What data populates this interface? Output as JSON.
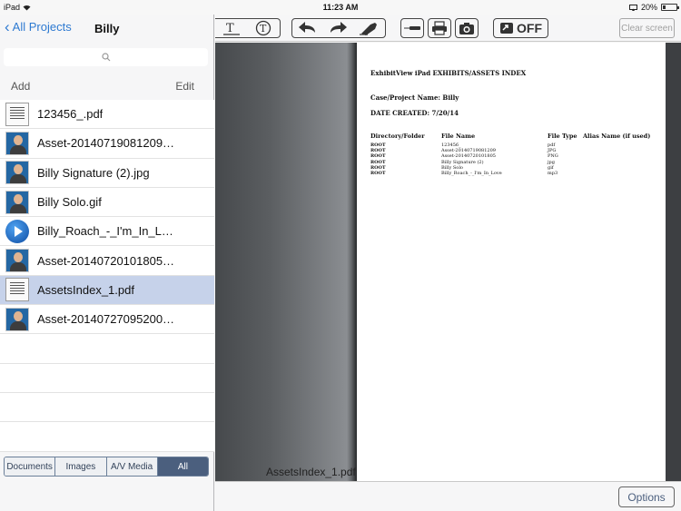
{
  "status_bar": {
    "device": "iPad",
    "time": "11:23 AM",
    "battery": "20%"
  },
  "left_pane": {
    "back_label": "All Projects",
    "title": "Billy",
    "add_label": "Add",
    "edit_label": "Edit",
    "files": [
      {
        "name": "123456_.pdf",
        "icon": "document-icon"
      },
      {
        "name": "Asset-20140719081209…",
        "icon": "image-thumbnail-icon"
      },
      {
        "name": "Billy Signature (2).jpg",
        "icon": "image-thumbnail-icon"
      },
      {
        "name": "Billy Solo.gif",
        "icon": "image-thumbnail-icon"
      },
      {
        "name": "Billy_Roach_-_I'm_In_L…",
        "icon": "media-play-icon"
      },
      {
        "name": "Asset-20140720101805…",
        "icon": "image-thumbnail-icon"
      },
      {
        "name": "AssetsIndex_1.pdf",
        "icon": "document-icon",
        "selected": true
      },
      {
        "name": "Asset-20140727095200…",
        "icon": "image-thumbnail-icon"
      }
    ],
    "filter_tabs": [
      "Documents",
      "Images",
      "A/V Media",
      "All"
    ],
    "active_filter": "All"
  },
  "toolbar": {
    "clear_screen_label": "Clear screen",
    "toggle_label": "OFF",
    "icons": [
      "text-tool-icon",
      "text-circle-tool-icon",
      "undo-icon",
      "redo-icon",
      "eraser-icon",
      "pen-icon",
      "print-icon",
      "camera-icon",
      "presentation-toggle-icon"
    ]
  },
  "document": {
    "heading": "ExhibitView iPad EXHIBITS/ASSETS INDEX",
    "case_line": "Case/Project Name: Billy",
    "date_line": "DATE CREATED: 7/20/14",
    "columns": [
      "Directory/Folder",
      "File Name",
      "File Type",
      "Alias Name (if used)"
    ],
    "rows": [
      [
        "ROOT",
        "123456_",
        "pdf",
        ""
      ],
      [
        "ROOT",
        "Asset-20140719081209",
        "JPG",
        ""
      ],
      [
        "ROOT",
        "Asset-20140720101805",
        "PNG",
        ""
      ],
      [
        "ROOT",
        "Billy Signature (2)",
        "jpg",
        ""
      ],
      [
        "ROOT",
        "Billy Solo",
        "gif",
        ""
      ],
      [
        "ROOT",
        "Billy_Roach_-_I'm_In_Love",
        "mp3",
        ""
      ]
    ],
    "filename_label": "AssetsIndex_1.pdf"
  },
  "bottom_bar": {
    "options_label": "Options"
  }
}
